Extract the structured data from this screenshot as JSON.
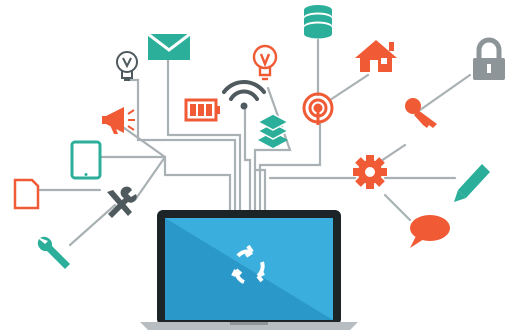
{
  "colors": {
    "line": "#aab1b4",
    "teal": "#2baf9a",
    "orange": "#f05a35",
    "gray": "#8e9598",
    "dark": "#4f5a5e",
    "screen_blue": "#2a98c9",
    "screen_light": "#3aaedc",
    "laptop_frame": "#1d2427",
    "laptop_base": "#b7bdc0"
  },
  "icons": [
    "database-icon",
    "email-icon",
    "lightbulb-icon",
    "idea-bulb-icon",
    "home-icon",
    "padlock-icon",
    "wifi-icon",
    "battery-icon",
    "broadcast-icon",
    "megaphone-icon",
    "layers-icon",
    "key-icon",
    "tablet-icon",
    "gear-icon",
    "pencil-icon",
    "document-icon",
    "tools-icon",
    "speech-bubble-icon",
    "wrench-icon",
    "sync-icon"
  ]
}
